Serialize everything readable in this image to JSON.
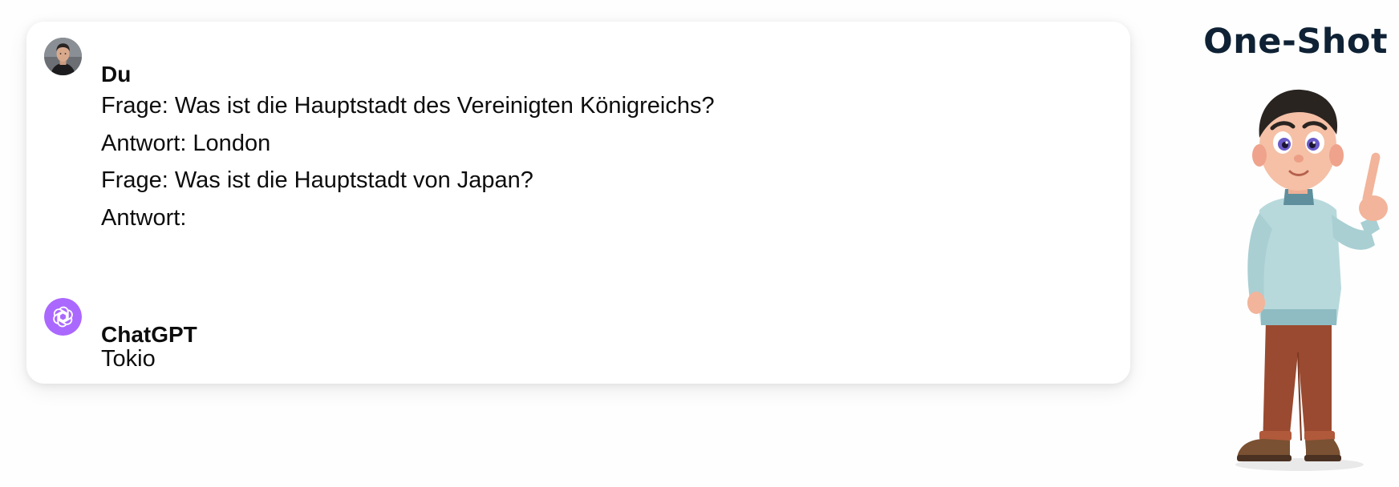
{
  "title": "One-Shot",
  "messages": [
    {
      "author": "Du",
      "avatar_icon": "user-photo-avatar",
      "lines": [
        "Frage: Was ist die Hauptstadt des Vereinigten Königreichs?",
        "Antwort: London",
        "Frage: Was ist die Hauptstadt von Japan?",
        "Antwort:"
      ]
    },
    {
      "author": "ChatGPT",
      "avatar_icon": "openai-logo-icon",
      "avatar_color": "#ab68ff",
      "lines": [
        "Tokio"
      ]
    }
  ],
  "illustration": "cartoon-man-pointing-up"
}
